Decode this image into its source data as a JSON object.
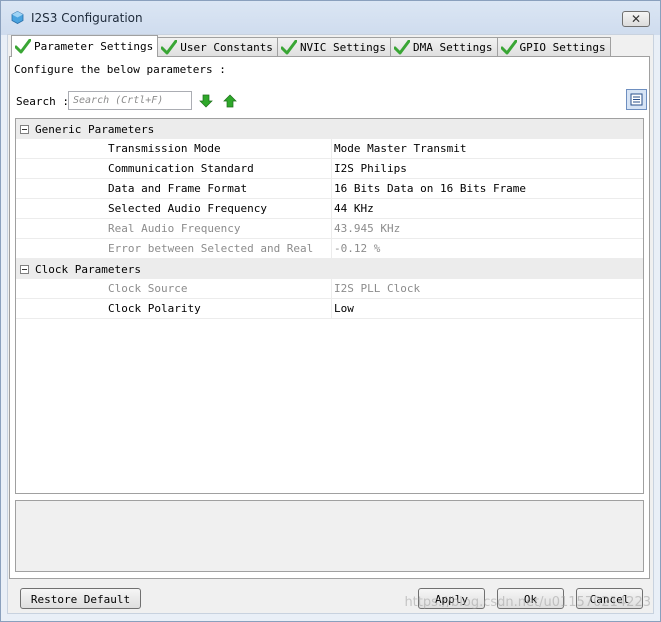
{
  "window": {
    "title": "I2S3 Configuration",
    "close_label": "✕"
  },
  "tabs": [
    {
      "label": "Parameter Settings",
      "active": true
    },
    {
      "label": "User Constants",
      "active": false
    },
    {
      "label": "NVIC Settings",
      "active": false
    },
    {
      "label": "DMA Settings",
      "active": false
    },
    {
      "label": "GPIO Settings",
      "active": false
    }
  ],
  "panel": {
    "instruction": "Configure the below parameters :",
    "search_label": "Search :",
    "search_placeholder": "Search (Crtl+F)"
  },
  "groups": [
    {
      "title": "Generic Parameters",
      "rows": [
        {
          "name": "Transmission Mode",
          "value": "Mode Master Transmit",
          "disabled": false
        },
        {
          "name": "Communication Standard",
          "value": "I2S Philips",
          "disabled": false
        },
        {
          "name": "Data and Frame Format",
          "value": "16 Bits Data on 16 Bits Frame",
          "disabled": false
        },
        {
          "name": "Selected Audio Frequency",
          "value": "44 KHz",
          "disabled": false
        },
        {
          "name": "Real Audio Frequency",
          "value": "43.945 KHz",
          "disabled": true
        },
        {
          "name": "Error between Selected and Real",
          "value": "-0.12 %",
          "disabled": true
        }
      ]
    },
    {
      "title": "Clock Parameters",
      "rows": [
        {
          "name": "Clock Source",
          "value": "I2S PLL Clock",
          "disabled": true
        },
        {
          "name": "Clock Polarity",
          "value": "Low",
          "disabled": false
        }
      ]
    }
  ],
  "buttons": {
    "restore": "Restore Default",
    "apply": "Apply",
    "ok": "Ok",
    "cancel": "Cancel"
  },
  "watermark": "https://blog.csdn.net/u011570214223",
  "colors": {
    "check_green": "#3aa635",
    "arrow_green": "#2fa82a",
    "disabled_text": "#8c8c8c"
  }
}
